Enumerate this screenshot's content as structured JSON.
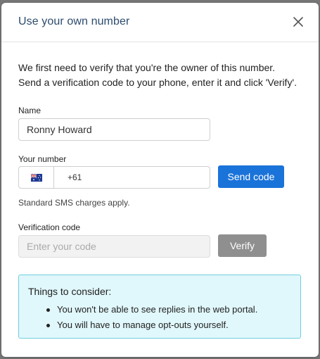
{
  "dialog": {
    "title": "Use your own number",
    "intro": "We first need to verify that you're the owner of this number. Send a verification code to your phone, enter it and click 'Verify'."
  },
  "name_field": {
    "label": "Name",
    "value": "Ronny Howard"
  },
  "number_field": {
    "label": "Your number",
    "country_flag_icon": "australia-flag-icon",
    "value": "+61",
    "send_button": "Send code",
    "hint": "Standard SMS charges apply."
  },
  "verification_field": {
    "label": "Verification code",
    "placeholder": "Enter your code",
    "verify_button": "Verify"
  },
  "notice": {
    "title": "Things to consider:",
    "items": [
      "You won't be able to see replies in the web portal.",
      "You will have to manage opt-outs yourself."
    ]
  },
  "colors": {
    "primary_button": "#1a73d9",
    "disabled_button": "#8f8f8f",
    "notice_background": "#e0f7fb",
    "notice_border": "#6fd0de",
    "title": "#2c4b6e"
  }
}
